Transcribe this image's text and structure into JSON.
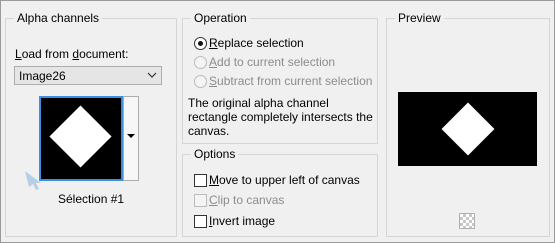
{
  "alpha_channels": {
    "title": "Alpha channels",
    "load_from_label": "Load from document:",
    "document_value": "Image26",
    "selection_name": "Sélection #1"
  },
  "operation": {
    "title": "Operation",
    "replace": "Replace selection",
    "add": "Add to current selection",
    "subtract": "Subtract from current selection",
    "selected": "replace",
    "description": "The original alpha channel rectangle completely intersects the canvas."
  },
  "options": {
    "title": "Options",
    "move_to_upper_left": "Move to upper left of canvas",
    "clip_to_canvas": "Clip to canvas",
    "invert_image": "Invert image",
    "move_checked": false,
    "clip_checked": false,
    "invert_checked": false
  },
  "preview": {
    "title": "Preview",
    "transparency_icon": "checkerboard-icon"
  },
  "colors": {
    "accent_border": "#3c8fe0",
    "preview_bg": "#000000",
    "shape": "#ffffff"
  }
}
